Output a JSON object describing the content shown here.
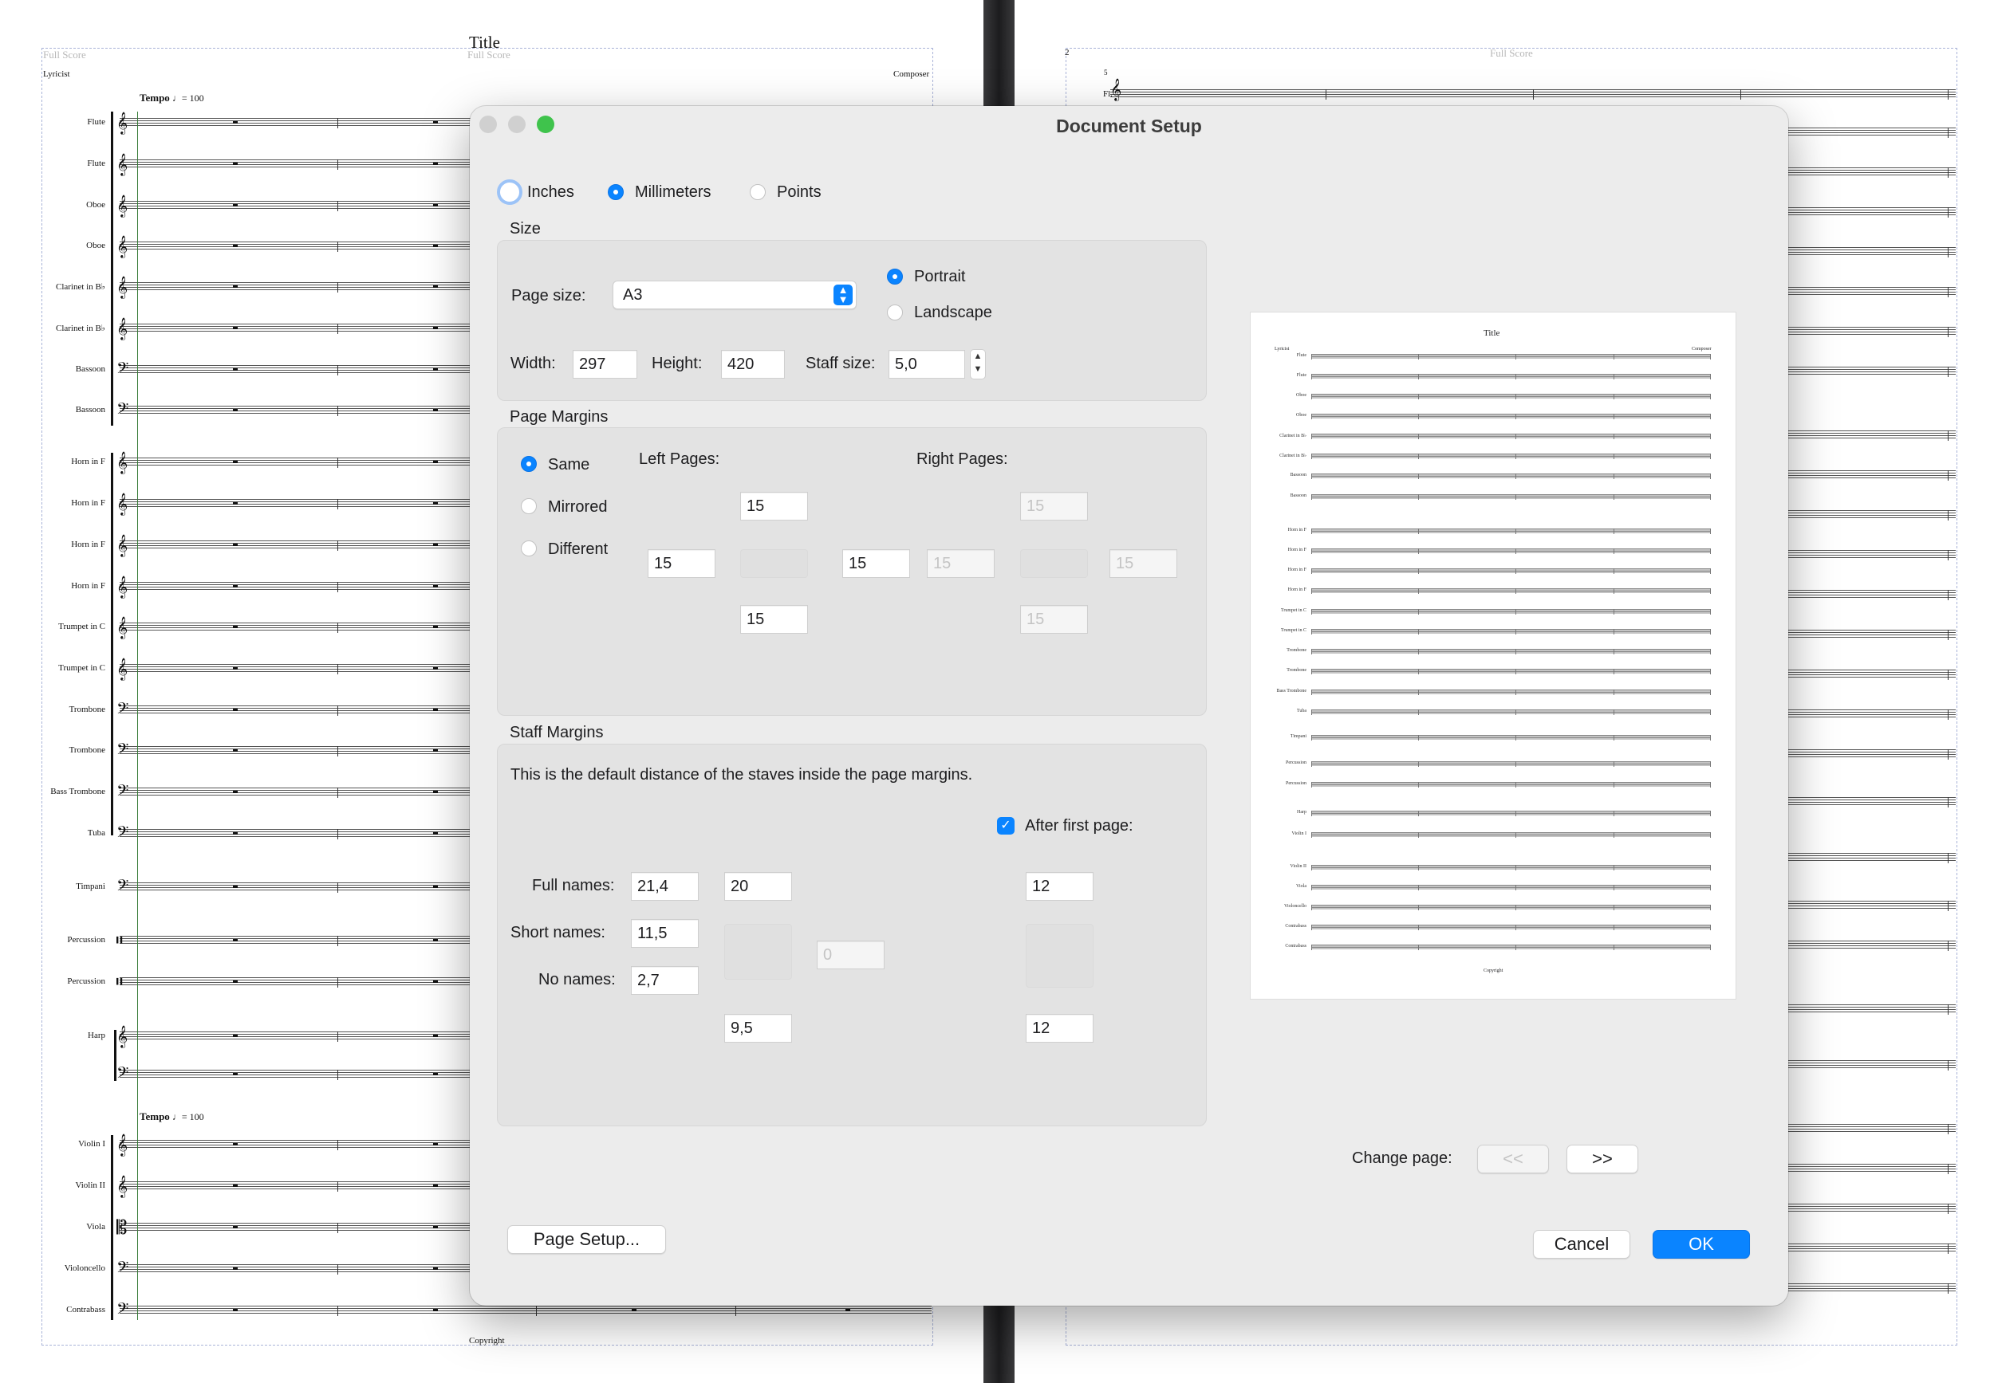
{
  "score": {
    "header": "Full Score",
    "title": "Title",
    "lyricist": "Lyricist",
    "composer": "Composer",
    "tempo_word": "Tempo",
    "tempo_mark": "♩= 100",
    "copyright": "Copyright",
    "page_number": "2",
    "right_page_instrument": "Fl.",
    "right_page_measure": "5",
    "instruments": [
      "Flute",
      "Flute",
      "Oboe",
      "Oboe",
      "Clarinet in B♭",
      "Clarinet in B♭",
      "Bassoon",
      "Bassoon",
      "Horn in F",
      "Horn in F",
      "Horn in F",
      "Horn in F",
      "Trumpet in C",
      "Trumpet in C",
      "Trombone",
      "Trombone",
      "Bass Trombone",
      "Tuba",
      "Timpani",
      "Percussion",
      "Percussion",
      "Harp",
      "Violin I",
      "Violin II",
      "Viola",
      "Violoncello",
      "Contrabass"
    ]
  },
  "dialog": {
    "title": "Document Setup",
    "units": {
      "inches": "Inches",
      "millimeters": "Millimeters",
      "points": "Points",
      "selected": "Millimeters"
    },
    "size": {
      "section": "Size",
      "page_size_label": "Page size:",
      "page_size_value": "A3",
      "portrait": "Portrait",
      "landscape": "Landscape",
      "orientation": "Portrait",
      "width_label": "Width:",
      "width": "297",
      "height_label": "Height:",
      "height": "420",
      "staff_size_label": "Staff size:",
      "staff_size": "5,0"
    },
    "page_margins": {
      "section": "Page Margins",
      "same": "Same",
      "mirrored": "Mirrored",
      "different": "Different",
      "selected": "Same",
      "left_pages": "Left Pages:",
      "right_pages": "Right Pages:",
      "left": {
        "top": "15",
        "left": "15",
        "right": "15",
        "bottom": "15"
      },
      "right": {
        "top": "15",
        "left": "15",
        "right": "15",
        "bottom": "15"
      }
    },
    "staff_margins": {
      "section": "Staff Margins",
      "description": "This is the default distance of the staves inside the page margins.",
      "after_first_page": "After first page:",
      "full_names_label": "Full names:",
      "full_names": "21,4",
      "short_names_label": "Short names:",
      "short_names": "11,5",
      "no_names_label": "No names:",
      "no_names": "2,7",
      "first_top": "20",
      "first_bottom": "9,5",
      "first_right": "0",
      "after_top": "12",
      "after_bottom": "12"
    },
    "change_page_label": "Change page:",
    "prev_page": "<<",
    "next_page": ">>",
    "page_setup_button": "Page Setup...",
    "cancel_button": "Cancel",
    "ok_button": "OK",
    "colors": {
      "accent": "#0a84ff",
      "close": "#d0d0d0",
      "zoom": "#3fc34c"
    }
  }
}
